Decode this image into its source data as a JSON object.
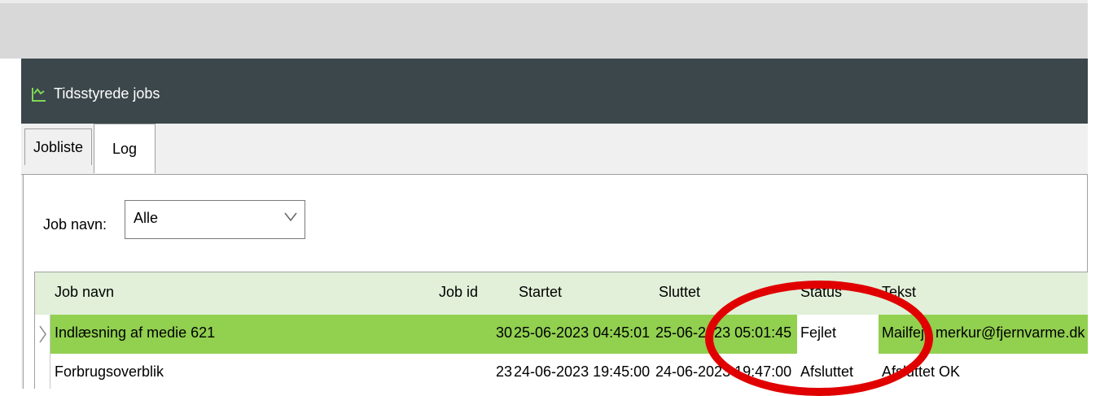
{
  "window": {
    "title": "Tidsstyrede jobs"
  },
  "tabs": [
    {
      "label": "Jobliste"
    },
    {
      "label": "Log"
    }
  ],
  "filter": {
    "label": "Job navn:",
    "value": "Alle"
  },
  "grid": {
    "columns": [
      "Job navn",
      "Job id",
      "Startet",
      "Sluttet",
      "Status",
      "Tekst"
    ],
    "rows": [
      {
        "job_navn": "Indlæsning af medie 621",
        "job_id": "30",
        "startet": "25-06-2023 04:45:01",
        "sluttet": "25-06-2023 05:01:45",
        "status": "Fejlet",
        "tekst": "Mailfejl: merkur@fjernvarme.dk"
      },
      {
        "job_navn": "Forbrugsoverblik",
        "job_id": "23",
        "startet": "24-06-2023 19:45:00",
        "sluttet": "24-06-2023 19:47:00",
        "status": "Afsluttet",
        "tekst": "Afsluttet OK"
      }
    ]
  },
  "colors": {
    "titlebar": "#3c474b",
    "selected_row": "#92d050",
    "header_row": "#e2f0d9",
    "annotation": "#e00000"
  }
}
